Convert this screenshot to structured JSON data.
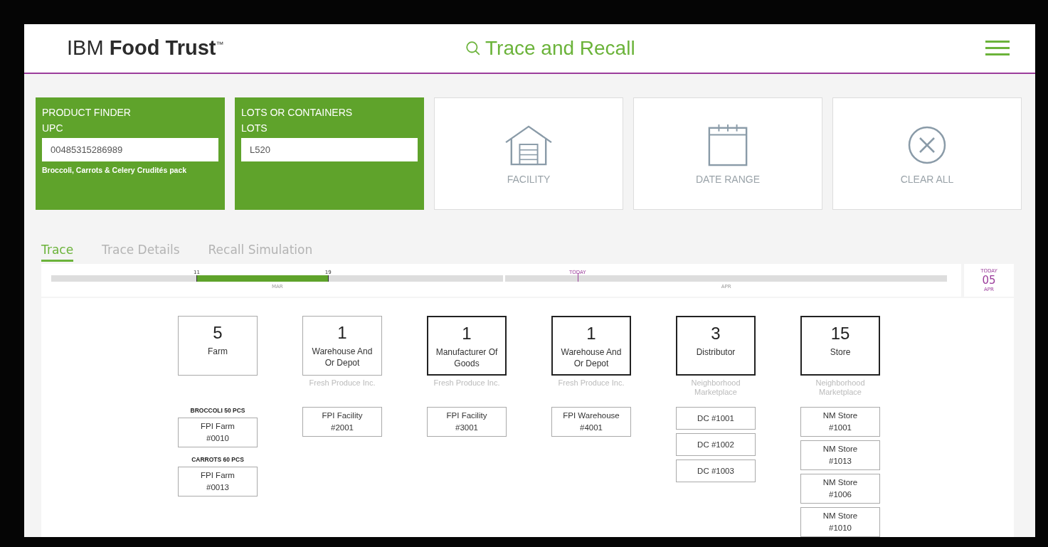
{
  "header": {
    "brand_light": "IBM",
    "brand_bold": "Food Trust",
    "brand_mark": "™",
    "page_title": "Trace and Recall"
  },
  "filters": [
    {
      "kind": "input",
      "title": "PRODUCT FINDER",
      "label": "UPC",
      "value": "00485315286989",
      "note": "Broccoli, Carrots & Celery Crudités pack"
    },
    {
      "kind": "input",
      "title": "LOTS OR CONTAINERS",
      "label": "LOTS",
      "value": "L520"
    },
    {
      "kind": "facility",
      "label": "FACILITY"
    },
    {
      "kind": "date",
      "label": "DATE RANGE"
    },
    {
      "kind": "clear",
      "label": "CLEAR ALL"
    }
  ],
  "tabs": [
    {
      "label": "Trace",
      "selected": true
    },
    {
      "label": "Trace Details",
      "selected": false
    },
    {
      "label": "Recall Simulation",
      "selected": false
    }
  ],
  "timeline": {
    "range_start": "11",
    "range_end": "19",
    "today_marker": "TODAY",
    "months": [
      "MAR",
      "APR"
    ],
    "today_label": "TODAY",
    "today_day": "05",
    "today_month": "APR"
  },
  "stages": [
    {
      "count": "5",
      "name": "Farm",
      "emphasized": false,
      "groups": [
        {
          "heading": "BROCCOLI 50 PCS",
          "items": [
            "FPI Farm #0010"
          ]
        },
        {
          "heading": "CARROTS 60 PCS",
          "items": [
            "FPI Farm #0013"
          ]
        }
      ]
    },
    {
      "count": "1",
      "name": "Warehouse And Or Depot",
      "company": "Fresh Produce Inc.",
      "emphasized": false,
      "groups": [
        {
          "items": [
            "FPI Facility #2001"
          ]
        }
      ]
    },
    {
      "count": "1",
      "name": "Manufacturer Of Goods",
      "company": "Fresh Produce Inc.",
      "emphasized": true,
      "groups": [
        {
          "items": [
            "FPI Facility #3001"
          ]
        }
      ]
    },
    {
      "count": "1",
      "name": "Warehouse And Or Depot",
      "company": "Fresh Produce Inc.",
      "emphasized": true,
      "groups": [
        {
          "items": [
            "FPI Warehouse #4001"
          ]
        }
      ]
    },
    {
      "count": "3",
      "name": "Distributor",
      "company": "Neighborhood Marketplace",
      "emphasized": true,
      "groups": [
        {
          "items": [
            "DC #1001",
            "DC #1002",
            "DC #1003"
          ]
        }
      ]
    },
    {
      "count": "15",
      "name": "Store",
      "company": "Neighborhood Marketplace",
      "emphasized": true,
      "groups": [
        {
          "items": [
            "NM Store #1001",
            "NM Store #1013",
            "NM Store #1006",
            "NM Store #1010"
          ]
        }
      ]
    }
  ]
}
